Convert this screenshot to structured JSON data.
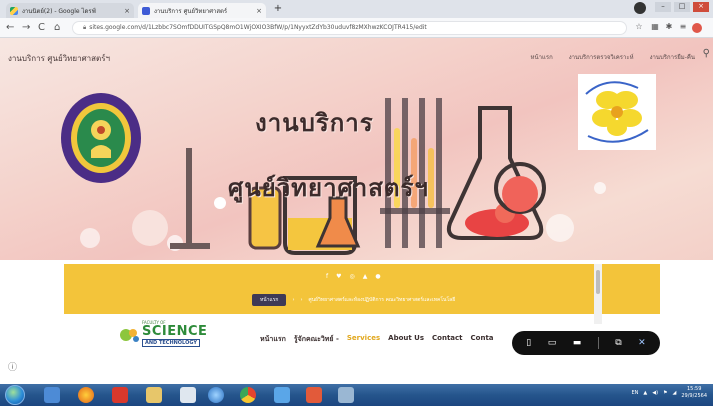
{
  "browser": {
    "tabs": [
      {
        "title": "งานนิตย์(2) - Google ไดรฟ์",
        "close": "×"
      },
      {
        "title": "งานบริการ ศูนย์วิทยาศาสตร์",
        "close": "×"
      }
    ],
    "new_tab": "+",
    "url": "sites.google.com/d/1Lzbbc7SOmfDDUITGSpQ8mO1WjOXIO3BfW/p/1NyyxtZdYb30uduvf8zMXhwzKCOJTR415/edit",
    "window_buttons": {
      "minimize": "–",
      "maximize": "□",
      "close": "×"
    }
  },
  "site": {
    "name": "งานบริการ ศูนย์วิทยาศาสตร์ฯ",
    "nav": [
      "หน้าแรก",
      "งานบริการตรวจวิเคราะห์",
      "งานบริการยืม-คืน"
    ],
    "headline_line1": "งานบริการ",
    "headline_line2": "ศูนย์วิทยาศาสตร์ฯ"
  },
  "preview": {
    "social_icons": [
      "f",
      "♥",
      "◎",
      "▲",
      "●"
    ],
    "breadcrumb_button": "หน้าแรก",
    "breadcrumb_text": "ศูนย์วิทยาศาสตร์และห้องปฏิบัติการ คณะวิทยาศาสตร์และเทคโนโลยี",
    "logo_faculty": "FACULTY OF",
    "logo_science": "SCIENCE",
    "logo_tech": "AND TECHNOLOGY",
    "nav": [
      {
        "label": "หน้าแรก"
      },
      {
        "label": "รู้จักคณะวิทย์ -"
      },
      {
        "label": "Services"
      },
      {
        "label": "About Us"
      },
      {
        "label": "Contact"
      },
      {
        "label": "Conta"
      }
    ]
  },
  "taskbar": {
    "language": "EN",
    "time": "15:59",
    "date": "29/9/2564"
  },
  "colors": {
    "accent_yellow": "#f3c43a",
    "services_active": "#e2a81e",
    "taskbar": "#25558c"
  }
}
